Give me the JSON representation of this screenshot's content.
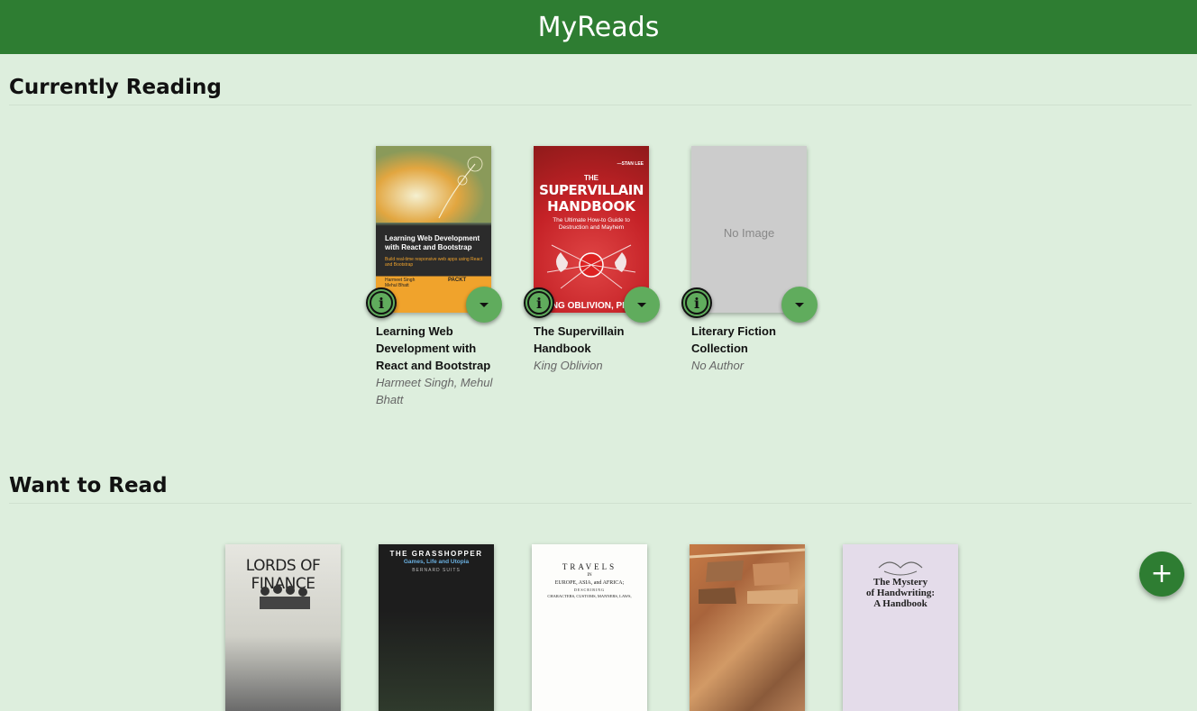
{
  "app": {
    "title": "MyReads"
  },
  "shelves": [
    {
      "title": "Currently Reading",
      "books": [
        {
          "title": "Learning Web Development with React and Bootstrap",
          "authors": "Harmeet Singh, Mehul Bhatt",
          "cover": {
            "title": "Learning Web Development with React and Bootstrap",
            "subtitle": "Build real-time responsive web apps using React and Bootstrap",
            "authors": "Harmeet Singh\nMehul Bhatt",
            "publisher": "PACKT"
          }
        },
        {
          "title": "The Supervillain Handbook",
          "authors": "King Oblivion",
          "cover": {
            "blurb_attribution": "—STAN LEE",
            "title_line1": "THE",
            "title_line2": "SUPERVILLAIN",
            "title_line3": "HANDBOOK",
            "subtitle": "The Ultimate How-to Guide to Destruction and Mayhem",
            "author": "KING OBLIVION, PH.D."
          }
        },
        {
          "title": "Literary Fiction Collection",
          "authors": "No Author",
          "cover": {
            "placeholder": "No Image"
          }
        }
      ]
    },
    {
      "title": "Want to Read",
      "books": [
        {
          "cover": {
            "title": "LORDS OF FINANCE"
          }
        },
        {
          "cover": {
            "title": "THE GRASSHOPPER",
            "subtitle": "Games, Life and Utopia",
            "author": "BERNARD SUITS"
          }
        },
        {
          "cover": {
            "line1": "TRAVELS",
            "line2": "IN",
            "line3": "EUROPE, ASIA, and AFRICA;",
            "line4": "DESCRIBING",
            "line5": "CHARACTERS, CUSTOMS, MANNERS, LAWS,"
          }
        },
        {
          "cover": {}
        },
        {
          "cover": {
            "title_line1": "The Mystery",
            "title_line2": "of Handwriting:",
            "title_line3": "A Handbook"
          }
        }
      ]
    }
  ],
  "icons": {
    "info": "info-icon",
    "shelf_menu": "arrow-drop-down-icon",
    "add": "add-icon"
  },
  "add_button": {
    "symbol": "+"
  },
  "colors": {
    "header": "#2e7d32",
    "background": "#ddeedd",
    "button": "#60ac5d"
  }
}
